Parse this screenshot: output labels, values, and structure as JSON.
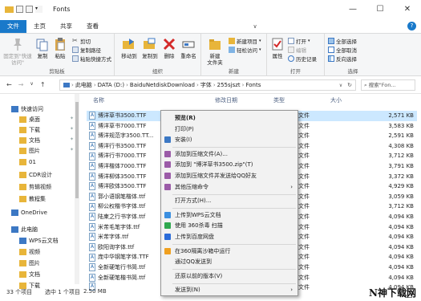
{
  "window": {
    "title": "Fonts",
    "controls": [
      "—",
      "☐",
      "✕"
    ]
  },
  "tabs": [
    "文件",
    "主页",
    "共享",
    "查看"
  ],
  "ribbon": {
    "clipboard": {
      "label": "剪贴板",
      "pin": "固定到\"快速访问\"",
      "copy": "复制",
      "paste": "粘贴",
      "cut": "剪切",
      "copy_path": "复制路径",
      "paste_shortcut": "粘贴快捷方式"
    },
    "organize": {
      "label": "组织",
      "move_to": "移动到",
      "copy_to": "复制到",
      "delete": "删除",
      "rename": "重命名"
    },
    "new": {
      "label": "新建",
      "new_folder": "新建\n文件夹",
      "new_item": "新建项目",
      "easy_access": "轻松访问"
    },
    "open": {
      "label": "打开",
      "properties": "属性",
      "open": "打开",
      "edit": "编辑",
      "history": "历史记录"
    },
    "select": {
      "label": "选择",
      "select_all": "全部选择",
      "select_none": "全部取消",
      "invert": "反向选择"
    }
  },
  "address": {
    "crumbs": [
      "此电脑",
      "DATA (D:)",
      "BaiduNetdiskDownload",
      "字体",
      "255sjszt",
      "Fonts"
    ],
    "search_placeholder": "搜索\"Fon..."
  },
  "nav": {
    "items": [
      {
        "label": "快速访问",
        "level": 0
      },
      {
        "label": "桌面",
        "level": 1,
        "pinned": true
      },
      {
        "label": "下载",
        "level": 1,
        "pinned": true
      },
      {
        "label": "文档",
        "level": 1,
        "pinned": true
      },
      {
        "label": "图片",
        "level": 1,
        "pinned": true
      },
      {
        "label": "01",
        "level": 1
      },
      {
        "label": "CDR设计",
        "level": 1
      },
      {
        "label": "剪辑视频",
        "level": 1
      },
      {
        "label": "教程集",
        "level": 1
      },
      {
        "label": "OneDrive",
        "level": 0
      },
      {
        "label": "此电脑",
        "level": 0
      },
      {
        "label": "WPS云文档",
        "level": 1
      },
      {
        "label": "视频",
        "level": 1
      },
      {
        "label": "图片",
        "level": 1
      },
      {
        "label": "文档",
        "level": 1
      },
      {
        "label": "下载",
        "level": 1
      }
    ]
  },
  "columns": {
    "name": "名称",
    "modified": "修改日期",
    "type": "类型",
    "size": "大小"
  },
  "files": [
    {
      "name": "博洋草书3500.TTF",
      "type": "字体文件",
      "size": "2,571 KB",
      "selected": true
    },
    {
      "name": "博洋草书7000.TTF",
      "type": "字体文件",
      "size": "3,583 KB"
    },
    {
      "name": "博洋规范字3500.TT...",
      "type": "字体文件",
      "size": "2,591 KB"
    },
    {
      "name": "博洋行书3500.TTF",
      "type": "字体文件",
      "size": "4,308 KB"
    },
    {
      "name": "博洋行书7000.TTF",
      "type": "字体文件",
      "size": "3,712 KB"
    },
    {
      "name": "博洋楷体7000.TTF",
      "type": "字体文件",
      "size": "3,791 KB"
    },
    {
      "name": "博洋柳体3500.TTF",
      "type": "字体文件",
      "size": "3,372 KB"
    },
    {
      "name": "博洋欧体3500.TTF",
      "type": "字体文件",
      "size": "4,929 KB"
    },
    {
      "name": "郭小语钢笔楷体.ttf",
      "type": "字体文件",
      "size": "3,059 KB"
    },
    {
      "name": "柳公权楷书字体.ttf",
      "type": "字体文件",
      "size": "3,712 KB"
    },
    {
      "name": "陆柬之行书字体.ttf",
      "type": "字体文件",
      "size": "4,094 KB"
    },
    {
      "name": "米芾毛笔字体.ttf",
      "type": "字体文件",
      "size": "4,094 KB"
    },
    {
      "name": "米芾字体.ttf",
      "type": "字体文件",
      "size": "4,094 KB"
    },
    {
      "name": "欧阳询字体.ttf",
      "type": "字体文件",
      "size": "4,094 KB"
    },
    {
      "name": "庞中华钢笔字体.TTF",
      "type": "字体文件",
      "size": "4,094 KB"
    },
    {
      "name": "全新硬笔行书简.ttf",
      "type": "字体文件",
      "size": "4,094 KB"
    },
    {
      "name": "全新硬笔楷书简.ttf",
      "type": "字体文件",
      "size": "4,094 KB"
    },
    {
      "name": "",
      "type": "字体文件",
      "size": "4,094 KB"
    }
  ],
  "context_menu": [
    {
      "label": "预览(R)",
      "bold": true,
      "icon": "none"
    },
    {
      "label": "打印(P)",
      "icon": "none"
    },
    {
      "label": "安装(I)",
      "icon": "shield-icon"
    },
    {
      "label": "添加到压缩文件(A)...",
      "icon": "archive-icon",
      "sep_before": true
    },
    {
      "label": "添加到 \"博洋草书3500.zip\"(T)",
      "icon": "archive-icon"
    },
    {
      "label": "添加到压缩文件并发送给QQ好友",
      "icon": "archive-icon"
    },
    {
      "label": "其他压缩命令",
      "icon": "archive-icon",
      "submenu": true
    },
    {
      "label": "打开方式(H)...",
      "icon": "none",
      "sep_before": true
    },
    {
      "label": "上传到WPS云文档",
      "icon": "cloud-icon",
      "sep_before": true
    },
    {
      "label": "使用 360杀毒 扫描",
      "icon": "antivirus-icon"
    },
    {
      "label": "上传到百度网盘",
      "icon": "baidu-icon"
    },
    {
      "label": "在360隔离沙箱中运行",
      "icon": "sandbox-icon",
      "sep_before": true
    },
    {
      "label": "通过QQ发送到",
      "icon": "none"
    },
    {
      "label": "还原以前的版本(V)",
      "icon": "none",
      "sep_before": true
    },
    {
      "label": "发送到(N)",
      "icon": "none",
      "submenu": true,
      "sep_before": true
    }
  ],
  "status": {
    "count": "33 个项目",
    "selected": "选中 1 个项目",
    "size": "2.50 MB"
  },
  "watermark": "N神下载网"
}
